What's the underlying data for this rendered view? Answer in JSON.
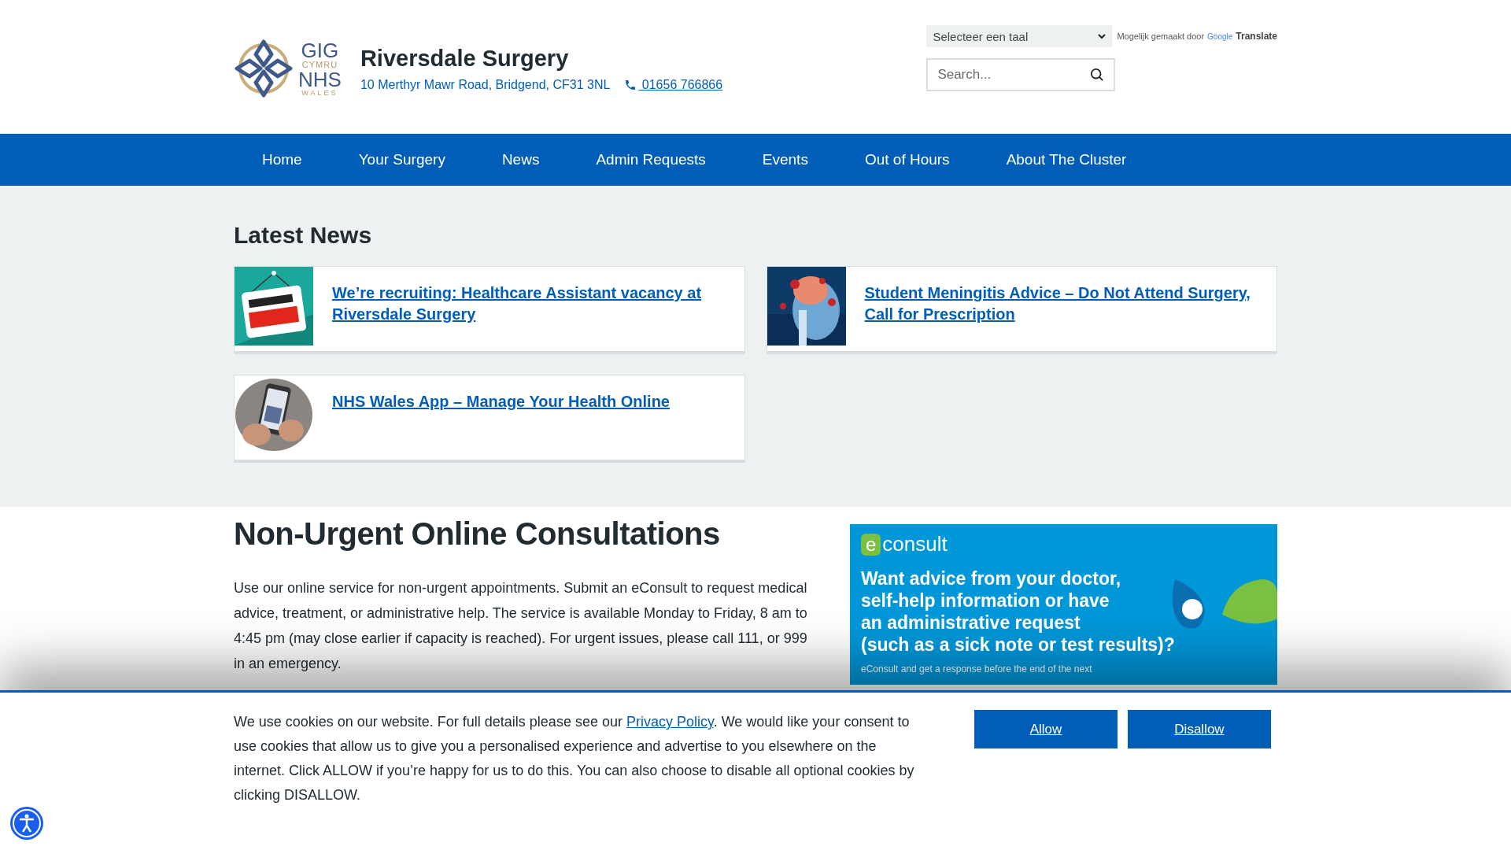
{
  "header": {
    "logo": [
      "GIG",
      "CYMRU",
      "NHS",
      "WALES"
    ],
    "title": "Riversdale Surgery",
    "address": "10 Merthyr Mawr Road, Bridgend, CF31 3NL",
    "phone": " 01656 766866",
    "language_select": "Selecteer een taal",
    "powered_by": "Mogelijk gemaakt door",
    "powered_brand": "Google",
    "powered_product": "Translate",
    "search": {
      "placeholder": "Search..."
    }
  },
  "nav": [
    {
      "label": "Home"
    },
    {
      "label": "Your Surgery"
    },
    {
      "label": "News"
    },
    {
      "label": "Admin Requests"
    },
    {
      "label": "Events"
    },
    {
      "label": "Out of Hours"
    },
    {
      "label": "About The Cluster"
    }
  ],
  "latest_news": {
    "title": "Latest News",
    "items": [
      {
        "title": "We’re recruiting: Healthcare Assistant vacancy at Riversdale Surgery"
      },
      {
        "title": "Student Meningitis Advice – Do Not Attend Surgery, Call for Prescription"
      },
      {
        "title": "NHS Wales App – Manage Your Health Online"
      }
    ]
  },
  "consultations": {
    "title": "Non-Urgent Online Consultations",
    "body": "Use our online service for non-urgent appointments. Submit an eConsult to request medical advice, treatment, or administrative help. The service is available Monday to Friday, 8 am to 4:45 pm (may close earlier if capacity is reached). For urgent issues, please call 111, or 999 in an emergency.",
    "banner": {
      "logo_mark": "e",
      "logo_text": "consult",
      "headline": [
        "Want advice from your doctor,",
        "self-help information or have",
        "an administrative request",
        "(such as a sick note or test results)?"
      ],
      "small": "eConsult and get a response before the end of the next"
    }
  },
  "cookie_banner": {
    "text_before": "We use cookies on our website. For full details please see our ",
    "link": "Privacy Policy",
    "text_after": ". We would like your consent to use cookies that allow us to give you a personalised experience and advertise to you elsewhere on the internet. Click ALLOW if you’re happy for us to do this. You can also choose to disable all optional cookies by clicking DISALLOW.",
    "buttons": [
      "Allow",
      "Disallow"
    ]
  }
}
